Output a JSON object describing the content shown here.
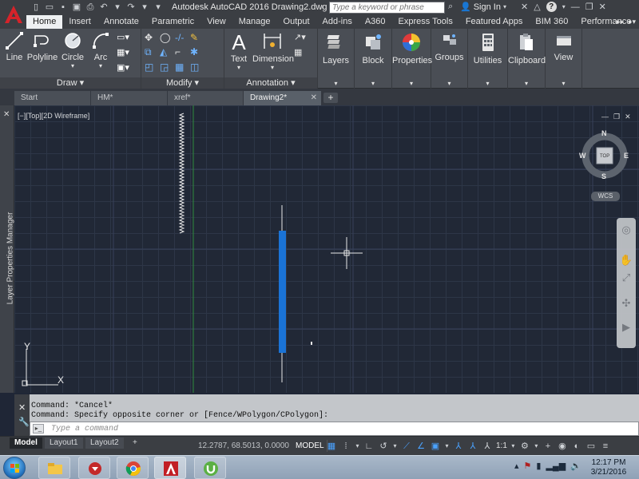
{
  "app": {
    "title": "Autodesk AutoCAD 2016    Drawing2.dwg",
    "search_placeholder": "Type a keyword or phrase",
    "sign_in": "Sign In"
  },
  "ribbon_tabs": [
    "Home",
    "Insert",
    "Annotate",
    "Parametric",
    "View",
    "Manage",
    "Output",
    "Add-ins",
    "A360",
    "Express Tools",
    "Featured Apps",
    "BIM 360",
    "Performance"
  ],
  "ribbon": {
    "draw": {
      "title": "Draw",
      "tools": [
        "Line",
        "Polyline",
        "Circle",
        "Arc"
      ]
    },
    "modify": {
      "title": "Modify"
    },
    "annotation": {
      "title": "Annotation",
      "tools": [
        "Text",
        "Dimension"
      ]
    },
    "panels": [
      "Layers",
      "Block",
      "Properties",
      "Groups",
      "Utilities",
      "Clipboard",
      "View"
    ]
  },
  "doc_tabs": [
    {
      "label": "Start",
      "active": false
    },
    {
      "label": "HM*",
      "active": false
    },
    {
      "label": "xref*",
      "active": false
    },
    {
      "label": "Drawing2*",
      "active": true
    }
  ],
  "viewport": {
    "label": "[−][Top][2D Wireframe]",
    "sidebar_label": "Layer Properties Manager"
  },
  "viewcube": {
    "north": "N",
    "south": "S",
    "east": "E",
    "west": "W",
    "face": "TOP",
    "wcs": "WCS"
  },
  "ucs": {
    "x": "X",
    "y": "Y"
  },
  "command": {
    "history": [
      "Command: *Cancel*",
      "Command: Specify opposite corner or [Fence/WPolygon/CPolygon]:"
    ],
    "placeholder": "Type a command"
  },
  "layout_tabs": [
    "Model",
    "Layout1",
    "Layout2"
  ],
  "status": {
    "coords": "12.2787, 68.5013, 0.0000",
    "model": "MODEL",
    "scale": "1:1"
  },
  "taskbar": {
    "time": "12:17 PM",
    "date": "3/21/2016"
  },
  "colors": {
    "canvas": "#212836",
    "accent_red": "#d6232a",
    "selection_blue": "#1a73d6"
  }
}
